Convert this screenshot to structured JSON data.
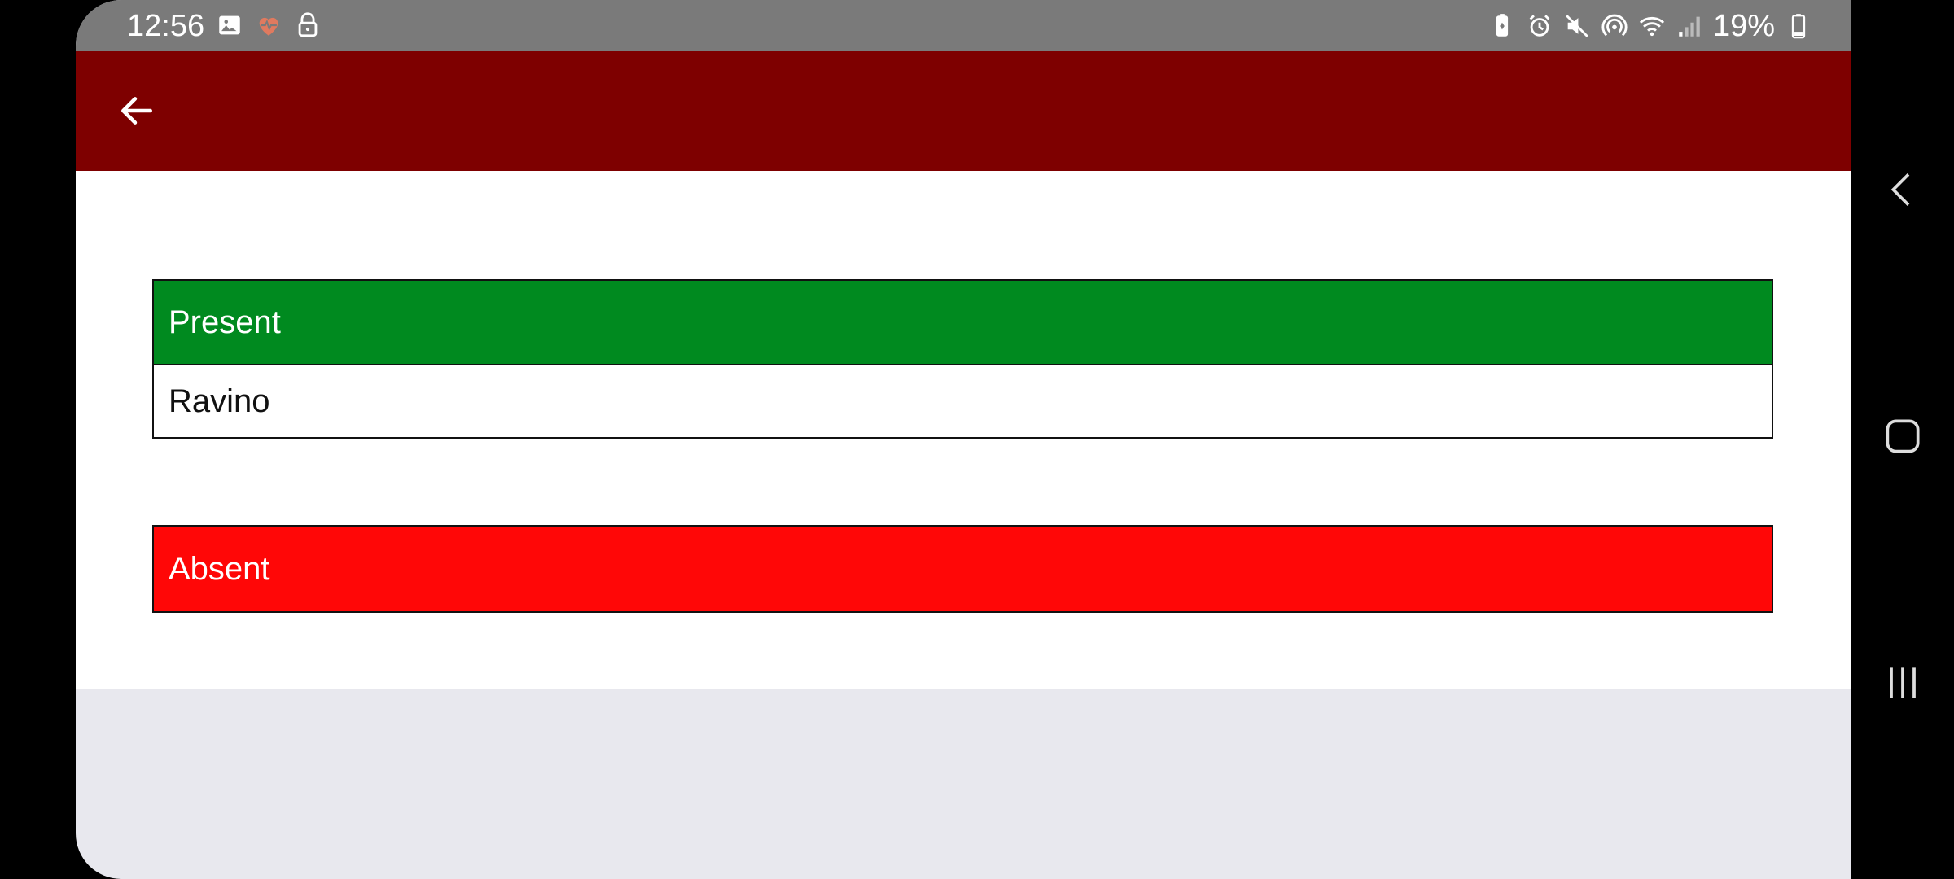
{
  "status_bar": {
    "time": "12:56",
    "battery_percent": "19%",
    "left_icons": [
      "image-icon",
      "health-icon",
      "lock-icon"
    ],
    "right_icons": [
      "battery-saver-icon",
      "alarm-icon",
      "mute-icon",
      "hotspot-icon",
      "wifi-icon",
      "signal-icon",
      "battery-icon"
    ]
  },
  "app_bar": {
    "back_icon": "arrow-left-icon",
    "color": "#7e0000"
  },
  "present": {
    "header": "Present",
    "color": "#008a1f",
    "rows": [
      "Ravino"
    ]
  },
  "absent": {
    "header": "Absent",
    "color": "#ff0707",
    "rows": []
  },
  "nav_bar": {
    "back_icon": "nav-back-icon",
    "home_icon": "nav-home-icon",
    "recents_icon": "nav-recents-icon"
  }
}
